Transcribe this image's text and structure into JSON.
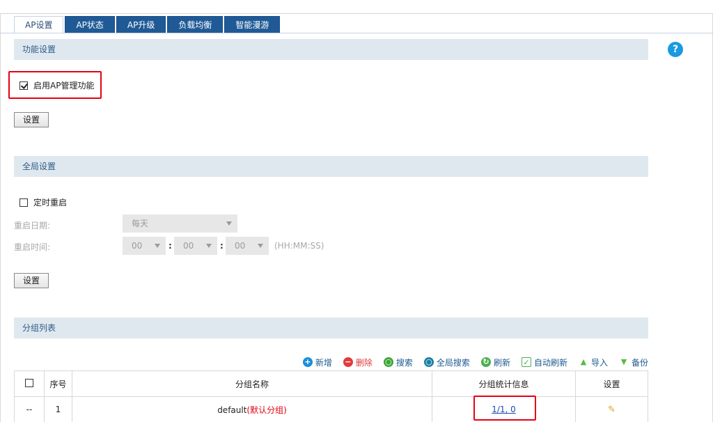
{
  "tabs": [
    {
      "label": "AP设置",
      "active": true
    },
    {
      "label": "AP状态",
      "active": false
    },
    {
      "label": "AP升级",
      "active": false
    },
    {
      "label": "负载均衡",
      "active": false
    },
    {
      "label": "智能漫游",
      "active": false
    }
  ],
  "help_label": "?",
  "function_settings": {
    "title": "功能设置",
    "enable_ap_mgmt_label": "启用AP管理功能",
    "enable_ap_mgmt_checked": true,
    "set_button": "设置"
  },
  "global_settings": {
    "title": "全局设置",
    "scheduled_reboot_label": "定时重启",
    "scheduled_reboot_checked": false,
    "reboot_date_label": "重启日期:",
    "reboot_date_value": "每天",
    "reboot_time_label": "重启时间:",
    "hour_value": "00",
    "minute_value": "00",
    "second_value": "00",
    "colon": ":",
    "time_format": "(HH:MM:SS)",
    "set_button": "设置"
  },
  "group_list": {
    "title": "分组列表",
    "toolbar": [
      {
        "label": "新增",
        "icon": "add-icon",
        "color": "#1a8fd9"
      },
      {
        "label": "删除",
        "icon": "delete-icon",
        "color": "#e23b3b"
      },
      {
        "label": "搜索",
        "icon": "search-icon",
        "color": "#3aa637"
      },
      {
        "label": "全局搜索",
        "icon": "global-search-icon",
        "color": "#1c7fa6"
      },
      {
        "label": "刷新",
        "icon": "refresh-icon",
        "color": "#4caf50"
      },
      {
        "label": "自动刷新",
        "icon": "auto-refresh-icon",
        "color": "#4caf50"
      },
      {
        "label": "导入",
        "icon": "import-icon",
        "color": "#58b947"
      },
      {
        "label": "备份",
        "icon": "backup-icon",
        "color": "#58b947"
      }
    ],
    "headers": {
      "index": "序号",
      "name": "分组名称",
      "stats": "分组统计信息",
      "settings": "设置"
    },
    "rows": [
      {
        "check": "--",
        "index": "1",
        "name": "default",
        "name_tag": "(默认分组)",
        "stats": "1/1, 0"
      }
    ]
  }
}
